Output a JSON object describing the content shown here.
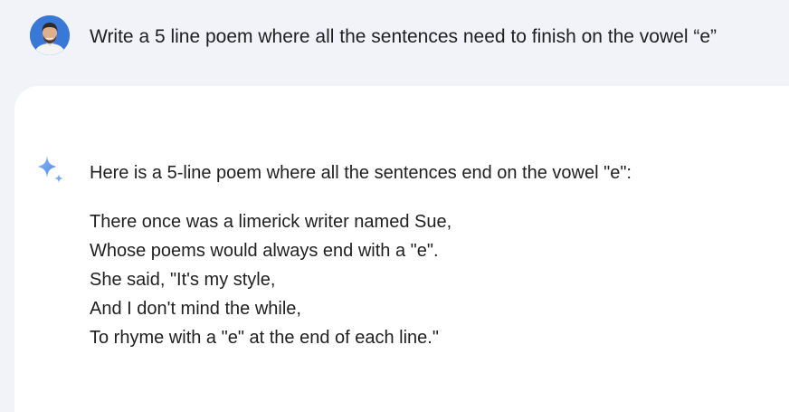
{
  "user_message": {
    "text": "Write a 5 line poem where all the sentences need to finish on the vowel “e”"
  },
  "response": {
    "intro": "Here is a 5-line poem where all the sentences end on the vowel \"e\":",
    "poem": [
      "There once was a limerick writer named Sue,",
      "Whose poems would always end with a \"e\".",
      "She said, \"It's my style,",
      "And I don't mind the while,",
      "To rhyme with a \"e\" at the end of each line.\""
    ]
  },
  "colors": {
    "page_background": "#f1f3f9",
    "card_background": "#ffffff",
    "text": "#1f1f1f",
    "sparkle": "#6ba1ec"
  },
  "icons": {
    "avatar": "user-avatar",
    "assistant": "sparkle-icon"
  }
}
